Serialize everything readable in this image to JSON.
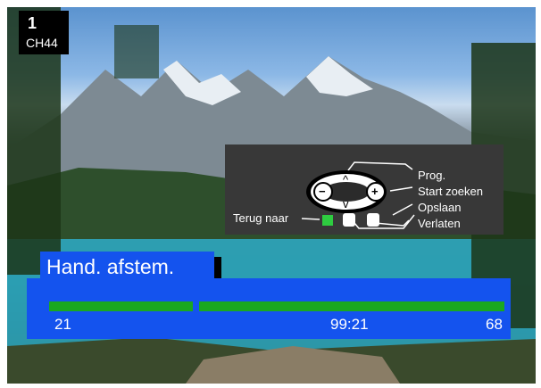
{
  "channel": {
    "program_number": "1",
    "channel_label": "CH44"
  },
  "remote_help": {
    "prog_label": "Prog.",
    "start_search_label": "Start zoeken",
    "save_label": "Opslaan",
    "back_label": "Terug naar",
    "exit_label": "Verlaten",
    "minus_symbol": "−",
    "plus_symbol": "+",
    "up_symbol": "^",
    "down_symbol": "v"
  },
  "menu": {
    "title": "Hand. afstem.",
    "value_left": "21",
    "value_center": "99:21",
    "value_right": "68",
    "bar_color": "#1aa81e",
    "panel_color": "#1453ee",
    "back_button_color": "#2ecc40"
  }
}
